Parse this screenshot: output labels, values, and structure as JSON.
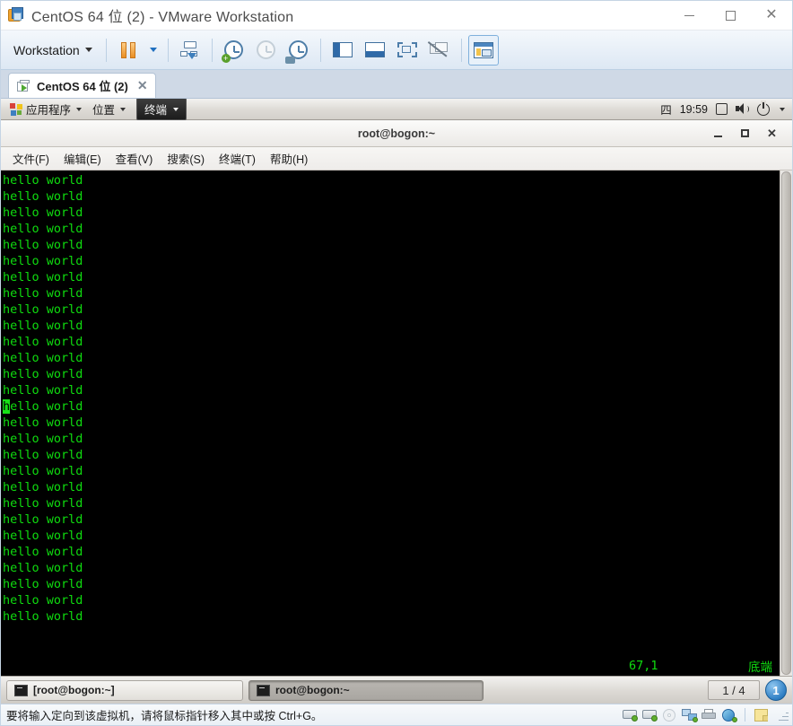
{
  "window": {
    "title": "CentOS 64 位 (2) - VMware Workstation",
    "app_icon": "vmware-icon",
    "minimize_label": "—",
    "maximize_label": "□",
    "close_label": "✕"
  },
  "toolbar": {
    "workstation_menu": "Workstation",
    "buttons": [
      {
        "name": "suspend-button",
        "icon": "pause-icon"
      },
      {
        "name": "suspend-dropdown",
        "icon": "chevron-down-icon"
      },
      {
        "name": "manage-snapshots-button",
        "icon": "snapshot-manager-icon"
      },
      {
        "name": "take-snapshot-button",
        "icon": "clock-plus-icon"
      },
      {
        "name": "revert-snapshot-button",
        "icon": "clock-revert-icon"
      },
      {
        "name": "snapshot-manager-button",
        "icon": "clock-wrench-icon"
      },
      {
        "name": "show-library-button",
        "icon": "library-panel-icon"
      },
      {
        "name": "show-thumbnails-button",
        "icon": "thumbnail-bar-icon"
      },
      {
        "name": "enter-fullscreen-button",
        "icon": "fullscreen-icon"
      },
      {
        "name": "unity-mode-button",
        "icon": "unity-mode-icon"
      },
      {
        "name": "console-view-button",
        "icon": "console-view-icon"
      }
    ]
  },
  "vm_tab": {
    "label": "CentOS 64 位 (2)",
    "icon": "vm-power-icon",
    "close_label": "✕"
  },
  "guest": {
    "gnome_panel": {
      "applications": "应用程序",
      "places": "位置",
      "window_entry": "终端",
      "day": "四",
      "clock": "19:59",
      "tray": [
        {
          "name": "display-icon",
          "icon": "screen-icon"
        },
        {
          "name": "volume-icon",
          "icon": "speaker-icon"
        },
        {
          "name": "power-menu-icon",
          "icon": "power-icon"
        }
      ]
    },
    "terminal": {
      "title": "root@bogon:~",
      "menus": [
        "文件(F)",
        "编辑(E)",
        "查看(V)",
        "搜索(S)",
        "终端(T)",
        "帮助(H)"
      ],
      "window_buttons": {
        "minimize": "_",
        "maximize": "□",
        "close": "✕"
      },
      "line_text": "hello world",
      "line_count": 28,
      "cursor_line_index": 14,
      "cursor_char": "h",
      "cursor_rest": "ello world",
      "status_position": "67,1",
      "status_state": "底端",
      "text_color": "#0fdc0f",
      "background_color": "#000000"
    },
    "taskbar": {
      "windows": [
        {
          "name": "taskbar-window-minimized",
          "label": "[root@bogon:~]",
          "active": false
        },
        {
          "name": "taskbar-window-active",
          "label": "root@bogon:~",
          "active": true
        }
      ],
      "workspace_switcher": "1 / 4",
      "workspace_badge": "1"
    }
  },
  "statusbar": {
    "message": "要将输入定向到该虚拟机，请将鼠标指针移入其中或按 Ctrl+G。",
    "devices": [
      {
        "name": "hard-disk-1-icon",
        "type": "hdd"
      },
      {
        "name": "hard-disk-2-icon",
        "type": "hdd"
      },
      {
        "name": "cd-dvd-icon",
        "type": "cd"
      },
      {
        "name": "network-adapter-icon",
        "type": "net"
      },
      {
        "name": "printer-icon",
        "type": "printer"
      },
      {
        "name": "usb-controller-icon",
        "type": "usb"
      },
      {
        "name": "sticky-note-icon",
        "type": "note"
      }
    ]
  },
  "colors": {
    "terminal_green": "#0fdc0f",
    "accent_blue": "#2f7fc4",
    "pause_orange": "#e98e22"
  }
}
